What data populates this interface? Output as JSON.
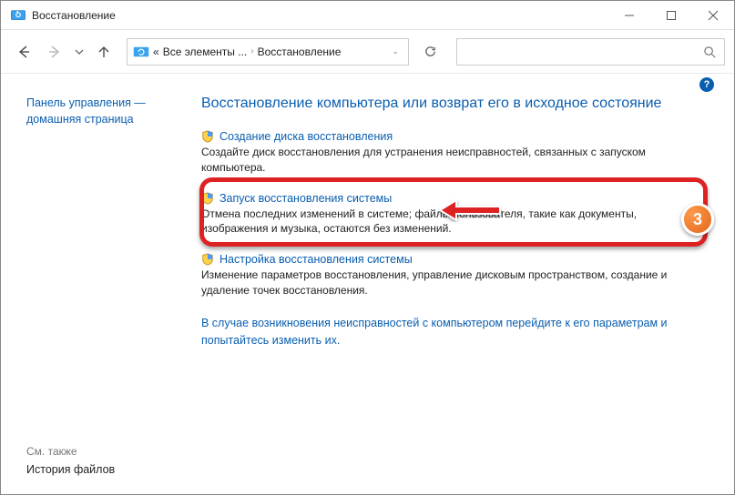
{
  "window": {
    "title": "Восстановление"
  },
  "breadcrumb": {
    "root": "Все элементы ...",
    "current": "Восстановление"
  },
  "sidebar": {
    "home_link": "Панель управления — домашняя страница",
    "see_also_label": "См. также",
    "file_history": "История файлов"
  },
  "main": {
    "heading": "Восстановление компьютера или возврат его в исходное состояние",
    "items": [
      {
        "title": "Создание диска восстановления",
        "desc": "Создайте диск восстановления для устранения неисправностей, связанных с запуском компьютера."
      },
      {
        "title": "Запуск восстановления системы",
        "desc": "Отмена последних изменений в системе; файлы пользователя, такие как документы, изображения и музыка, остаются без изменений."
      },
      {
        "title": "Настройка восстановления системы",
        "desc": "Изменение параметров восстановления, управление дисковым пространством, создание и удаление точек восстановления."
      }
    ],
    "final_link": "В случае возникновения неисправностей с компьютером перейдите к его параметрам и попытайтесь изменить их."
  },
  "annotation": {
    "step": "3"
  }
}
